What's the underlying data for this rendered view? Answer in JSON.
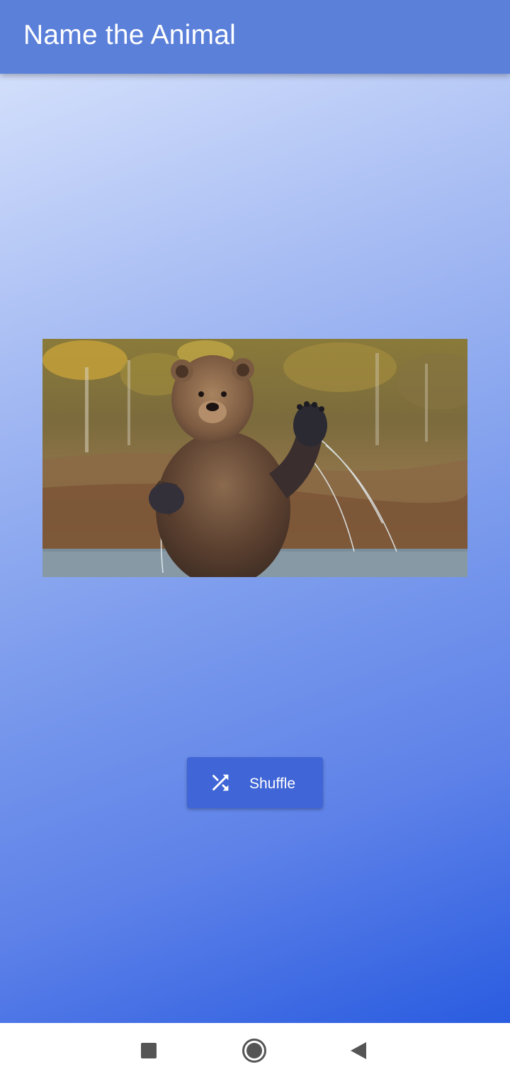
{
  "app_bar": {
    "title": "Name the Animal",
    "color": "#5b80d9"
  },
  "content": {
    "animal_image": {
      "subject": "brown bear waving paw"
    }
  },
  "shuffle_button": {
    "label": "Shuffle",
    "icon": "shuffle-icon",
    "color": "#3f65d6"
  },
  "nav_bar": {
    "buttons": [
      {
        "icon": "square-recents-icon"
      },
      {
        "icon": "circle-home-icon"
      },
      {
        "icon": "triangle-back-icon"
      }
    ]
  },
  "colors": {
    "gradient_start": "#dde7fd",
    "gradient_end": "#2a5ce0"
  }
}
